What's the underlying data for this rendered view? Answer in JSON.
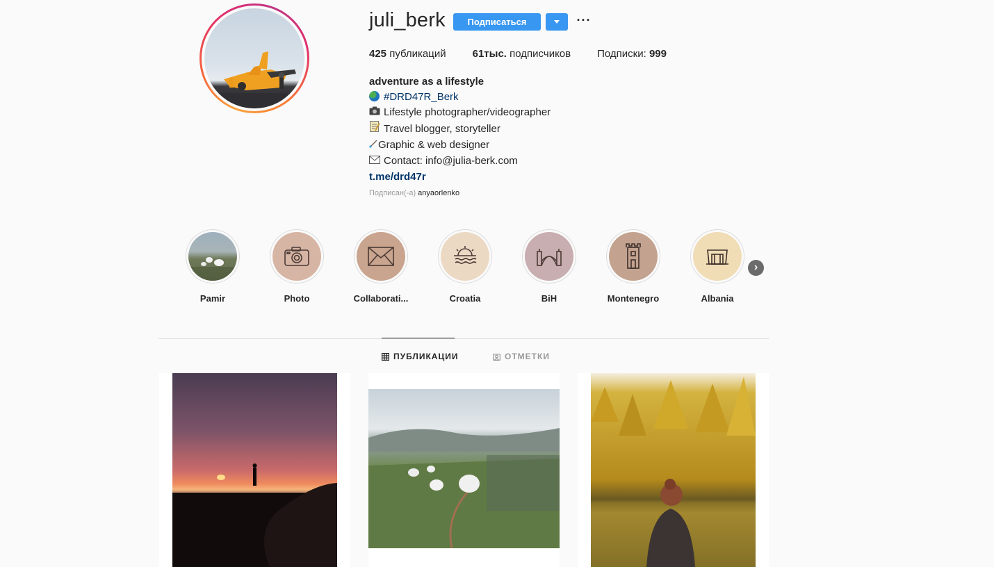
{
  "profile": {
    "username": "juli_berk",
    "follow_label": "Подписаться",
    "more_label": "···",
    "stats": {
      "posts_value": "425",
      "posts_label": " публикаций",
      "followers_value": "61тыс.",
      "followers_label": " подписчиков",
      "following_label": "Подписки: ",
      "following_value": "999"
    },
    "bio": {
      "name": "adventure as a lifestyle",
      "hashtag": "#DRD47R_Berk",
      "line_photo": "Lifestyle photographer/videographer",
      "line_travel": "Travel blogger, storyteller",
      "line_design": "Graphic & web designer",
      "line_contact": "Contact: info@julia-berk.com",
      "link": "t.me/drd47r"
    },
    "followed_by_prefix": "Подписан(-а) ",
    "followed_by_user": "anyaorlenko"
  },
  "highlights": [
    {
      "label": "Pamir",
      "icon": "landscape-photo",
      "color": "#8a9aa6"
    },
    {
      "label": "Photo",
      "icon": "camera-icon",
      "color": "#d7b5a5"
    },
    {
      "label": "Collaborati...",
      "icon": "envelope-icon",
      "color": "#c9a48e"
    },
    {
      "label": "Croatia",
      "icon": "sunset-icon",
      "color": "#ecd9c4"
    },
    {
      "label": "BiH",
      "icon": "bridge-icon",
      "color": "#c8aeb0"
    },
    {
      "label": "Montenegro",
      "icon": "tower-icon",
      "color": "#c3a38f"
    },
    {
      "label": "Albania",
      "icon": "monument-icon",
      "color": "#f0dcb5"
    }
  ],
  "tabs": {
    "posts_label": "ПУБЛИКАЦИИ",
    "tagged_label": "ОТМЕТКИ"
  },
  "colors": {
    "accent": "#3897f0",
    "link": "#003569",
    "border": "#dbdbdb"
  }
}
